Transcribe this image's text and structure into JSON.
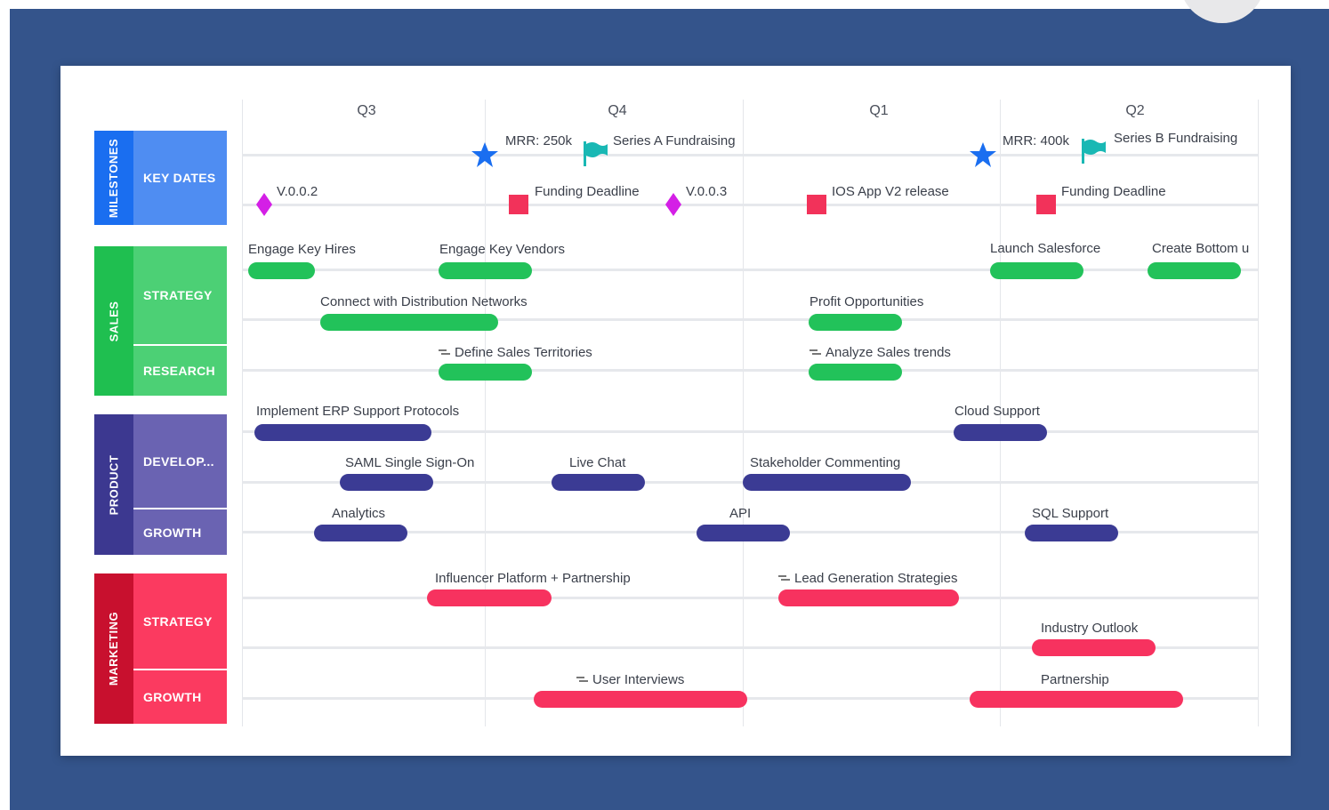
{
  "quarters": [
    "Q3",
    "Q4",
    "Q1",
    "Q2"
  ],
  "colors": {
    "background": "#34548b",
    "milestones_main": "#1a6ef0",
    "milestones_sub": "#4f8df2",
    "sales_main": "#1fbf50",
    "sales_sub": "#4cd075",
    "product_main": "#3c3890",
    "product_sub": "#6a63b2",
    "marketing_main": "#c8102e",
    "marketing_sub": "#fb3a60",
    "star": "#1a6ef0",
    "flag": "#19b8b4",
    "diamond": "#d41fe6",
    "square": "#f2325a"
  },
  "groups": {
    "milestones": {
      "label": "MILESTONES",
      "rows": [
        "KEY DATES"
      ]
    },
    "sales": {
      "label": "SALES",
      "rows": [
        "STRATEGY",
        "RESEARCH"
      ]
    },
    "product": {
      "label": "PRODUCT",
      "rows": [
        "DEVELOP...",
        "GROWTH"
      ]
    },
    "marketing": {
      "label": "MARKETING",
      "rows": [
        "STRATEGY",
        "GROWTH"
      ]
    }
  },
  "milestones": {
    "mrr1": "MRR: 250k",
    "flag1": "Series A Fundraising",
    "mrr2": "MRR: 400k",
    "flag2": "Series B Fundraising",
    "v002": "V.0.0.2",
    "deadline1": "Funding Deadline",
    "v003": "V.0.0.3",
    "ios": "IOS App V2 release",
    "deadline2": "Funding Deadline"
  },
  "tasks": {
    "engage_hires": "Engage Key Hires",
    "engage_vendors": "Engage Key Vendors",
    "launch_salesforce": "Launch Salesforce",
    "create_bottom": "Create Bottom u",
    "connect_networks": "Connect with Distribution Networks",
    "profit": "Profit Opportunities",
    "define_territories": "Define Sales Territories",
    "analyze_trends": "Analyze Sales trends",
    "erp": "Implement ERP Support Protocols",
    "cloud": "Cloud Support",
    "saml": "SAML Single Sign-On",
    "live_chat": "Live Chat",
    "stakeholder": "Stakeholder Commenting",
    "analytics": "Analytics",
    "api": "API",
    "sql": "SQL Support",
    "influencer": "Influencer Platform + Partnership",
    "lead_gen": "Lead Generation Strategies",
    "industry": "Industry Outlook",
    "user_interviews": "User Interviews",
    "partnership": "Partnership"
  }
}
